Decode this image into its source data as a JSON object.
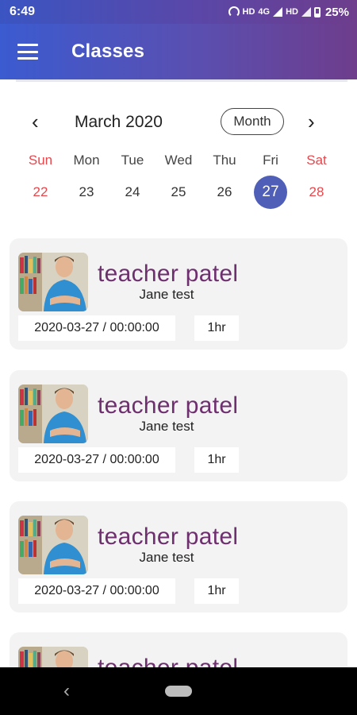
{
  "status_bar": {
    "time": "6:49",
    "network_text": "HD",
    "network_type": "4G",
    "network_text_2": "HD",
    "battery": "25%"
  },
  "app_bar": {
    "title": "Classes",
    "menu_icon": "hamburger-menu-icon"
  },
  "calendar": {
    "month_label": "March 2020",
    "view_mode": "Month",
    "prev_icon": "chevron-left-icon",
    "next_icon": "chevron-right-icon",
    "weekdays": [
      "Sun",
      "Mon",
      "Tue",
      "Wed",
      "Thu",
      "Fri",
      "Sat"
    ],
    "dates": [
      "22",
      "23",
      "24",
      "25",
      "26",
      "27",
      "28"
    ],
    "selected_date": "27",
    "weekend_color": "#e5484d",
    "selected_color": "#4f5fb8"
  },
  "classes": [
    {
      "teacher": "teacher patel",
      "student": "Jane test",
      "datetime": "2020-03-27 / 00:00:00",
      "duration": "1hr"
    },
    {
      "teacher": "teacher patel",
      "student": "Jane test",
      "datetime": "2020-03-27 / 00:00:00",
      "duration": "1hr"
    },
    {
      "teacher": "teacher patel",
      "student": "Jane test",
      "datetime": "2020-03-27 / 00:00:00",
      "duration": "1hr"
    },
    {
      "teacher": "teacher patel"
    }
  ],
  "colors": {
    "brand_start": "#3b5bd0",
    "brand_end": "#6e3d8c",
    "teacher_name": "#6e2f6e",
    "card_bg": "#f3f3f3"
  }
}
